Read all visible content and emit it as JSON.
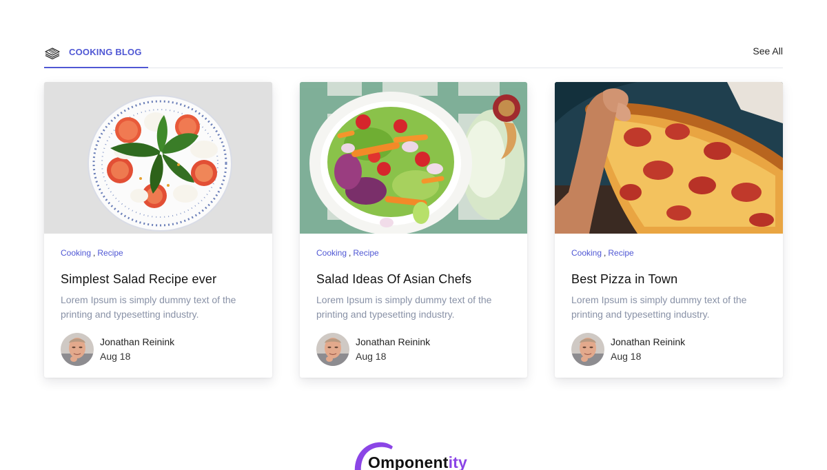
{
  "section": {
    "tab_label": "COOKING BLOG",
    "tab_icon": "newspaper-icon",
    "see_all_label": "See All",
    "accent_color": "#4f57d4"
  },
  "posts": [
    {
      "image": "salad-caprese-plate",
      "tag_1": "Cooking",
      "tag_sep": ",",
      "tag_2": "Recipe",
      "title": "Simplest Salad Recipe ever",
      "excerpt": "Lorem Ipsum is simply dummy text of the printing and typesetting industry.",
      "author_name": "Jonathan Reinink",
      "date": "Aug 18"
    },
    {
      "image": "salad-bowl-vegetables",
      "tag_1": "Cooking",
      "tag_sep": ",",
      "tag_2": "Recipe",
      "title": "Salad Ideas Of Asian Chefs",
      "excerpt": "Lorem Ipsum is simply dummy text of the printing and typesetting industry.",
      "author_name": "Jonathan Reinink",
      "date": "Aug 18"
    },
    {
      "image": "pizza-slice",
      "tag_1": "Cooking",
      "tag_sep": ",",
      "tag_2": "Recipe",
      "title": "Best Pizza in Town",
      "excerpt": "Lorem Ipsum is simply dummy text of the printing and typesetting industry.",
      "author_name": "Jonathan Reinink",
      "date": "Aug 18"
    }
  ],
  "footer": {
    "logo_text_main": "Omponent",
    "logo_text_accent": "ity",
    "logo_color": "#8b45e6"
  }
}
